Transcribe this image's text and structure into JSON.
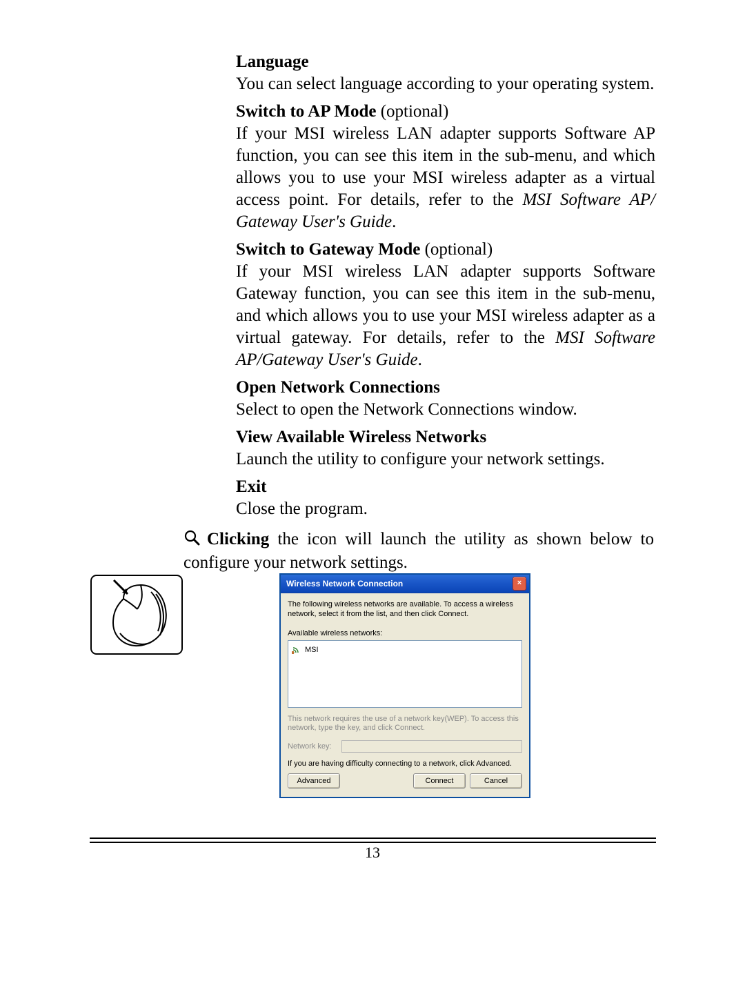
{
  "sections": {
    "language": {
      "title": "Language",
      "body": "You can select language according to your operating system."
    },
    "ap_mode": {
      "title": "Switch to AP Mode",
      "optional": " (optional)",
      "body_pre": "If your MSI wireless LAN adapter supports Software AP function, you can see this item in the sub-menu, and which allows you to use your MSI wireless adapter as a virtual access point.  For details, refer to the  ",
      "body_italic": "MSI Software AP/ Gateway User's Guide",
      "period": "."
    },
    "gateway_mode": {
      "title": "Switch to Gateway Mode",
      "optional": " (optional)",
      "body_pre": "If your MSI wireless LAN adapter supports Software Gateway function, you can see this item in the sub-menu, and which allows you to use your MSI wireless adapter as a virtual gateway.  For details, refer to the  ",
      "body_italic": "MSI Software AP/Gateway User's Guide",
      "period": "."
    },
    "open_net": {
      "title": "Open Network Connections",
      "body": "Select to open the Network Connections window."
    },
    "view_avail": {
      "title": "View Available Wireless Networks",
      "body": "Launch the utility to configure your network settings."
    },
    "exit": {
      "title": "Exit",
      "body": "Close the program."
    }
  },
  "click_note": {
    "bold": "Clicking",
    "rest": " the icon will launch the utility as shown below to configure your network settings."
  },
  "dialog": {
    "title": "Wireless Network Connection",
    "close_label": "×",
    "intro": "The following wireless networks are available. To access a wireless network, select it from the list, and then click Connect.",
    "list_label": "Available wireless networks:",
    "networks": [
      {
        "name": "MSI"
      }
    ],
    "wep_note": "This network requires the use of a network key(WEP). To access this network, type the key, and click Connect.",
    "key_label": "Network key:",
    "key_value": "",
    "adv_note": "If you are having difficulty connecting to a network, click Advanced.",
    "buttons": {
      "advanced": "Advanced",
      "connect": "Connect",
      "cancel": "Cancel"
    }
  },
  "page_number": "13",
  "icons": {
    "magnifier": "magnifier-icon",
    "wifi": "wifi-icon",
    "close": "close-icon",
    "mouse": "mouse-illustration"
  }
}
